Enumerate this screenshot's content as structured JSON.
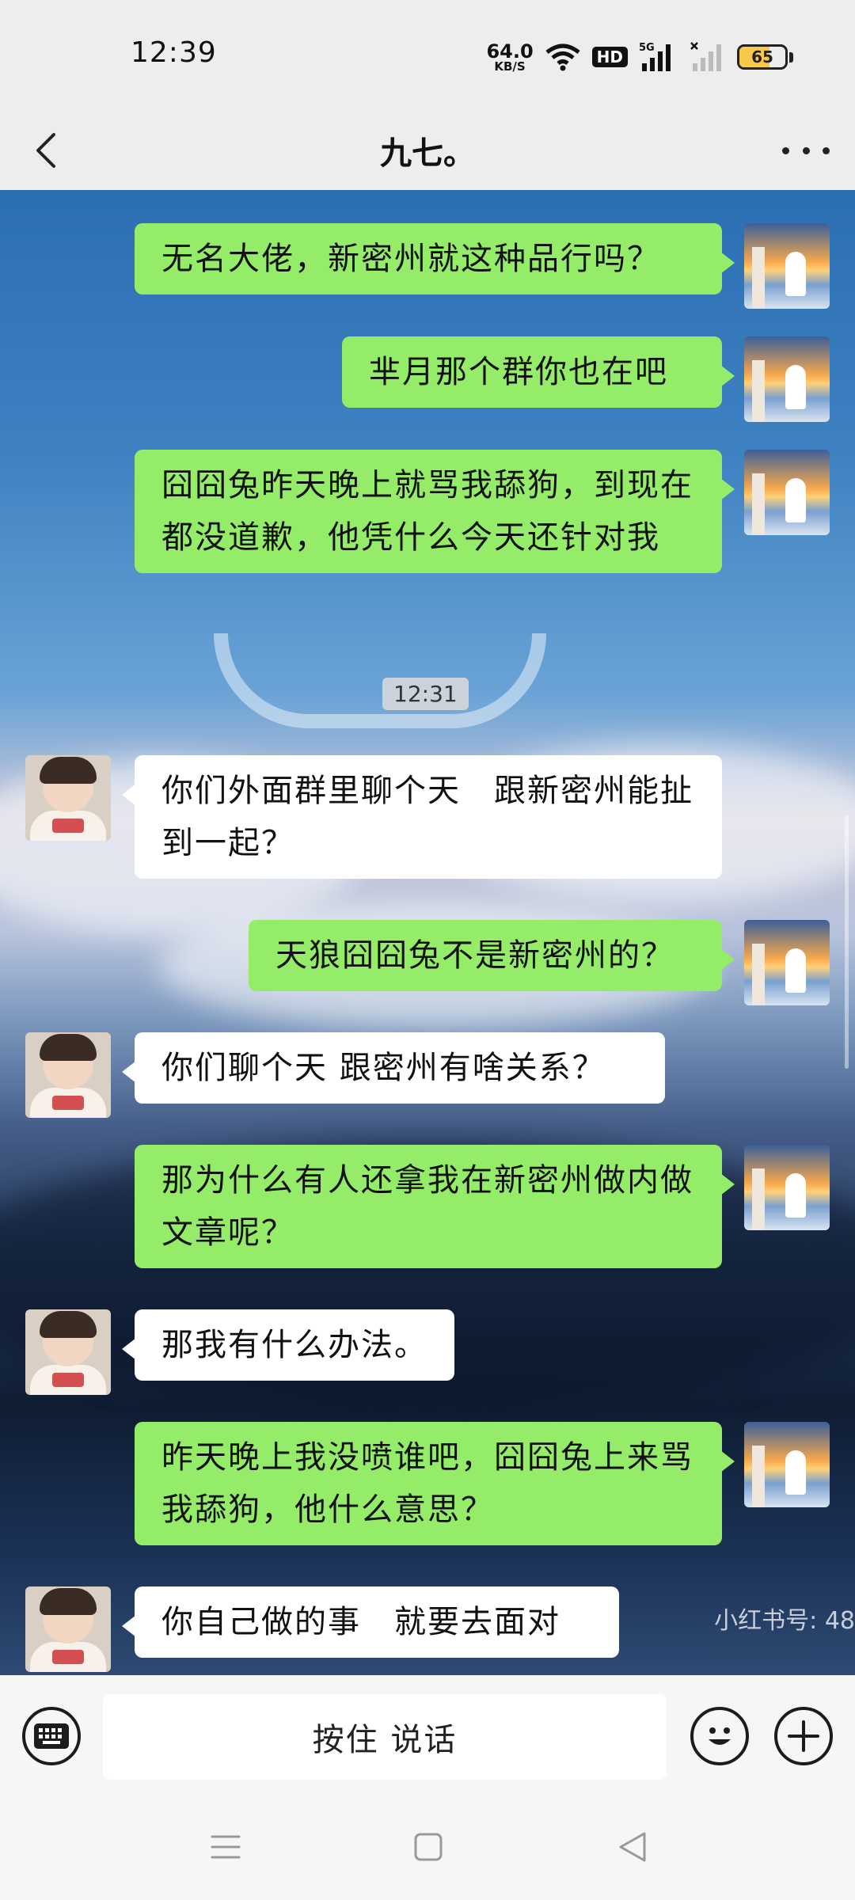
{
  "status_bar": {
    "time": "12:39",
    "net_speed_value": "64.0",
    "net_speed_unit": "KB/S",
    "hd_label": "HD",
    "network_type": "5G",
    "battery_level": "65",
    "battery_fraction": 0.65,
    "battery_color": "#f7c948"
  },
  "header": {
    "title": "九七。",
    "back_icon": "chevron-left-icon",
    "more_icon": "more-dots-icon"
  },
  "messages": [
    {
      "sender": "me",
      "text": "无名大佬，新密州就这种品行吗？"
    },
    {
      "sender": "me",
      "text": "芈月那个群你也在吧"
    },
    {
      "sender": "me",
      "text": "囧囧兔昨天晚上就骂我舔狗，到现在都没道歉，他凭什么今天还针对我"
    },
    {
      "sender": "system",
      "text": "12:31"
    },
    {
      "sender": "them",
      "text": "你们外面群里聊个天　跟新密州能扯到一起？"
    },
    {
      "sender": "me",
      "text": "天狼囧囧兔不是新密州的？"
    },
    {
      "sender": "them",
      "text": "你们聊个天  跟密州有啥关系？"
    },
    {
      "sender": "me",
      "text": "那为什么有人还拿我在新密州做内做文章呢？"
    },
    {
      "sender": "them",
      "text": "那我有什么办法。"
    },
    {
      "sender": "me",
      "text": "昨天晚上我没喷谁吧，囧囧兔上来骂我舔狗，他什么意思？"
    },
    {
      "sender": "them",
      "text": "你自己做的事　就要去面对"
    }
  ],
  "watermark": "小红书号: 48",
  "input_bar": {
    "hold_to_talk": "按住 说话",
    "keyboard_icon": "keyboard-icon",
    "emoji_icon": "emoji-icon",
    "plus_icon": "plus-icon"
  },
  "colors": {
    "my_bubble": "#95ec69",
    "their_bubble": "#ffffff",
    "bar_background": "#ededed"
  }
}
